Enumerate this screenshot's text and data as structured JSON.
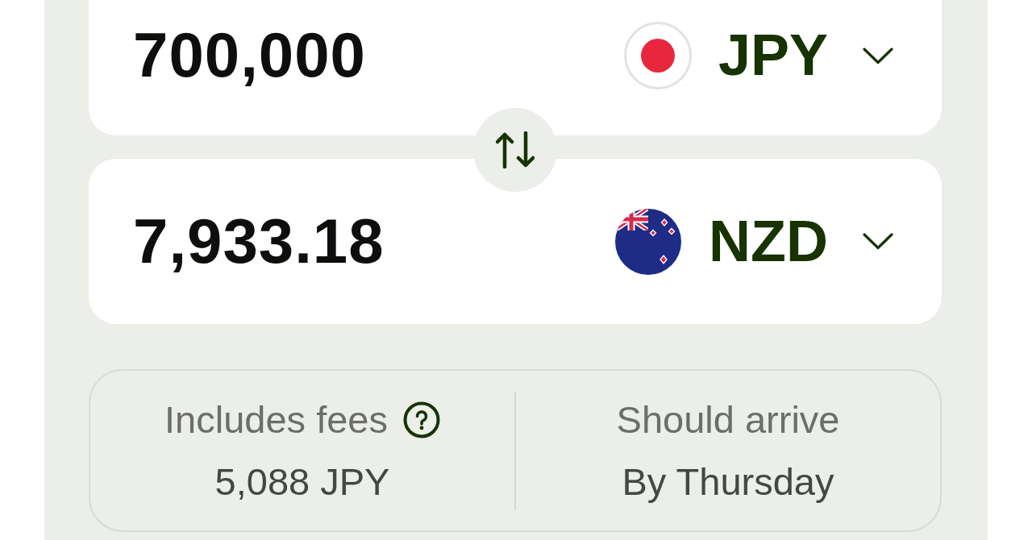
{
  "amounts": [
    {
      "amount": "700,000",
      "currency": "JPY"
    },
    {
      "amount": "7,933.18",
      "currency": "NZD"
    }
  ],
  "summary": [
    {
      "label": "Includes fees",
      "help": true,
      "value": "5,088 JPY"
    },
    {
      "label": "Should arrive",
      "help": false,
      "value": "By Thursday"
    }
  ]
}
